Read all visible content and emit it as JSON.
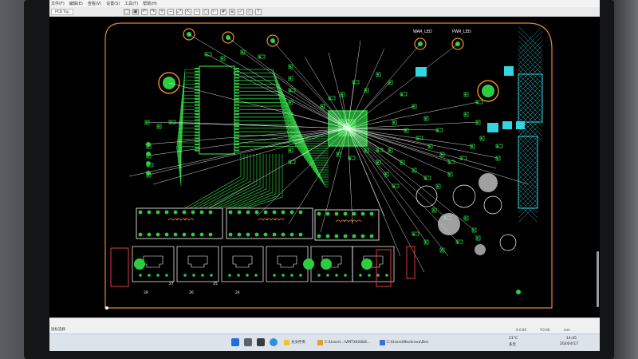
{
  "menu": [
    "文件(F)",
    "编辑(E)",
    "查看(V)",
    "设置(S)",
    "工具(T)",
    "帮助(H)"
  ],
  "document_tab": "PCB Top",
  "toolbar_buttons": [
    "open-icon",
    "save-icon",
    "undo-icon",
    "redo-icon",
    "zoom-in-icon",
    "zoom-out-icon",
    "fit-icon",
    "select-icon",
    "route-icon",
    "via-icon",
    "measure-icon",
    "grid-icon",
    "layers-icon",
    "drc-icon",
    "3d-icon",
    "help-icon"
  ],
  "pcb": {
    "labels": {
      "warn_led": "WAR_LED",
      "pwr_led": "PWR_LED"
    },
    "pin_labels_row1": [
      "28",
      "26",
      "24"
    ],
    "pin_labels_row2": [
      "27",
      "25"
    ],
    "colors": {
      "board_outline": "#e08a2c",
      "copper": "#2ecc40",
      "ratsnest": "#ffffff",
      "pad_cyan": "#33d6e0",
      "silkscreen_red": "#e23a3a"
    }
  },
  "status": {
    "left": "鼠标选择",
    "coord1": "X:0.00",
    "coord2": "Y:0.00",
    "unit": "mm"
  },
  "taskbar": {
    "apps": [
      {
        "label": "文文件夹",
        "color": "#f2c230"
      },
      {
        "label": "C:\\Users\\...\\VMT3020b6...",
        "color": "#e0a030"
      },
      {
        "label": "C:\\Users\\Mechrevo\\Des",
        "color": "#3a6fd8"
      }
    ],
    "weather": "21°C",
    "weather_sub": "多云",
    "time": "14:45",
    "date": "2024/4/17"
  }
}
